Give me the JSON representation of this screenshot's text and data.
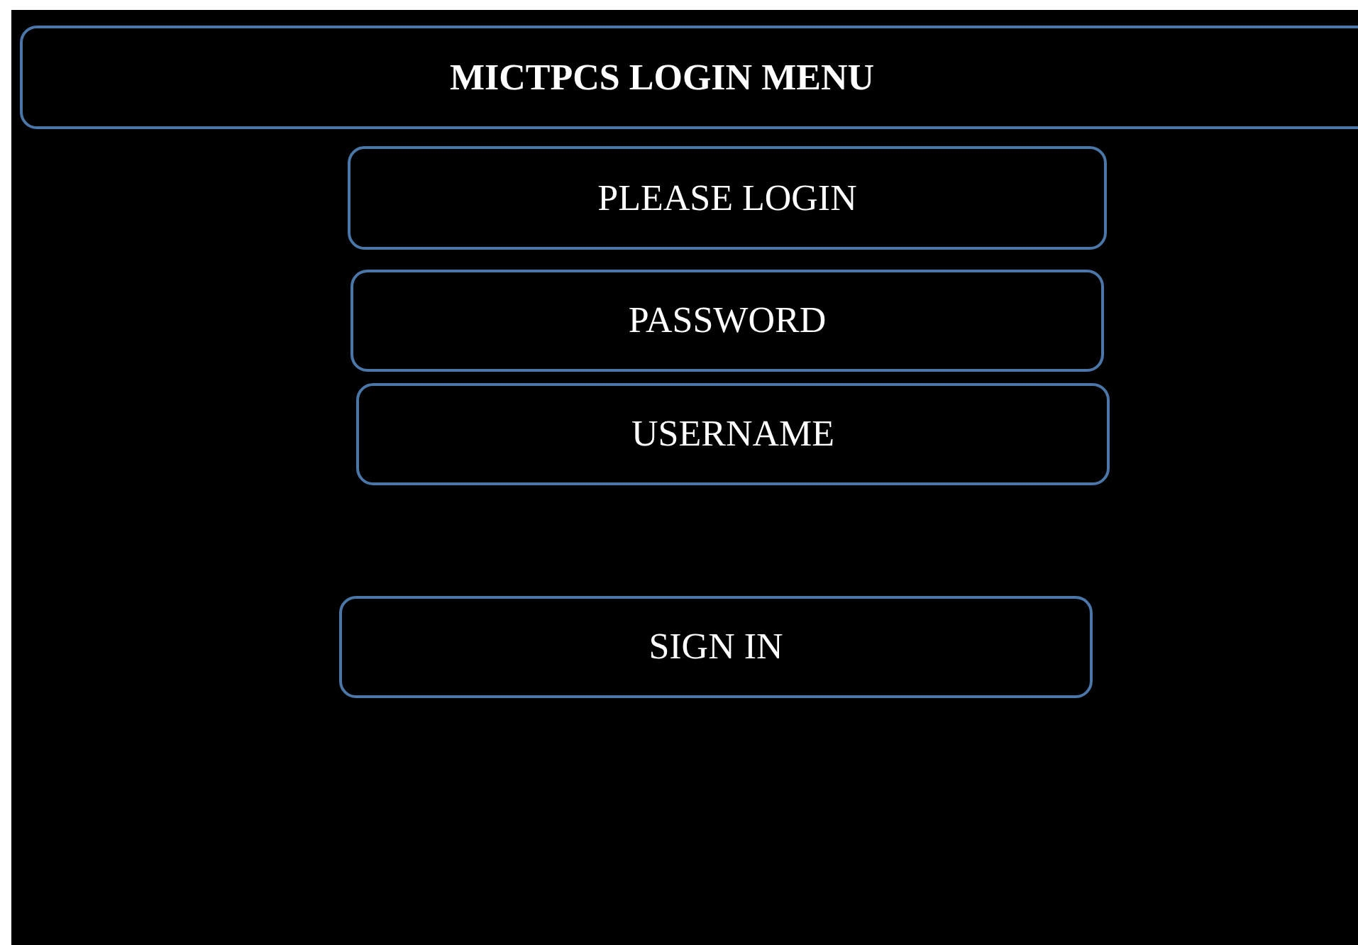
{
  "title": "MICTPCS LOGIN MENU",
  "items": [
    {
      "kind": "label",
      "text": "PLEASE LOGIN"
    },
    {
      "kind": "field",
      "placeholder": "PASSWORD"
    },
    {
      "kind": "field",
      "placeholder": "USERNAME"
    },
    {
      "kind": "button",
      "text": "SIGN IN"
    }
  ]
}
